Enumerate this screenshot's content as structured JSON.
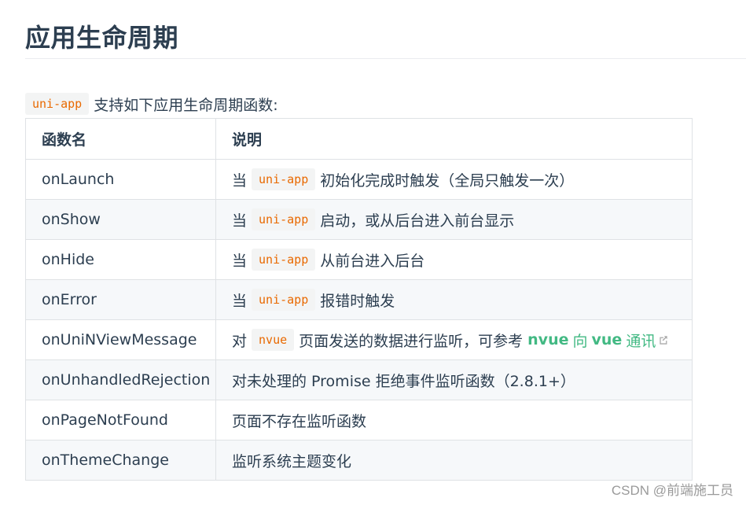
{
  "heading": "应用生命周期",
  "intro": {
    "code": "uni-app",
    "text": "支持如下应用生命周期函数:"
  },
  "table": {
    "headers": [
      "函数名",
      "说明"
    ],
    "rows": [
      {
        "name": "onLaunch",
        "pre": "当",
        "code": "uni-app",
        "post": "初始化完成时触发（全局只触发一次）"
      },
      {
        "name": "onShow",
        "pre": "当",
        "code": "uni-app",
        "post": "启动，或从后台进入前台显示"
      },
      {
        "name": "onHide",
        "pre": "当",
        "code": "uni-app",
        "post": "从前台进入后台"
      },
      {
        "name": "onError",
        "pre": "当",
        "code": "uni-app",
        "post": "报错时触发"
      },
      {
        "name": "onUniNViewMessage",
        "pre": "对",
        "code": "nvue",
        "post": "页面发送的数据进行监听，可参考",
        "link_a": "nvue",
        "link_b": "向",
        "link_c": "vue",
        "link_d": "通讯"
      },
      {
        "name": "onUnhandledRejection",
        "text": "对未处理的 Promise 拒绝事件监听函数（2.8.1+）"
      },
      {
        "name": "onPageNotFound",
        "text": "页面不存在监听函数"
      },
      {
        "name": "onThemeChange",
        "text": "监听系统主题变化"
      }
    ]
  },
  "watermark": "CSDN @前端施工员",
  "colors": {
    "text": "#2c3e50",
    "code": "#e96900",
    "link": "#42b983",
    "stripe": "#f6f8fa",
    "border": "#dfe2e5"
  },
  "icons": {
    "external_link": "external-link-icon"
  }
}
